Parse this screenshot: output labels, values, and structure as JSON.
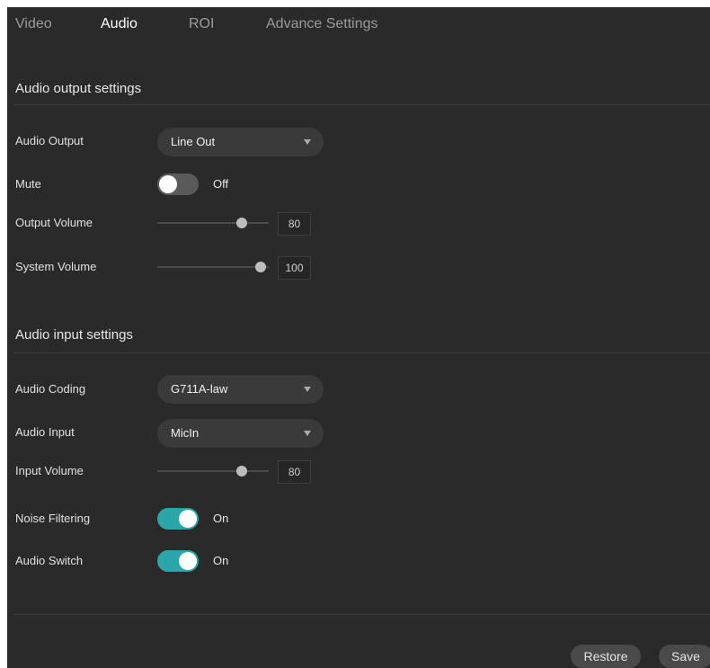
{
  "tabs": [
    {
      "label": "Video"
    },
    {
      "label": "Audio"
    },
    {
      "label": "ROI"
    },
    {
      "label": "Advance Settings"
    }
  ],
  "output_section": {
    "title": "Audio output settings",
    "audio_output": {
      "label": "Audio Output",
      "value": "Line Out"
    },
    "mute": {
      "label": "Mute",
      "state": "Off"
    },
    "output_volume": {
      "label": "Output Volume",
      "value": "80"
    },
    "system_volume": {
      "label": "System Volume",
      "value": "100"
    }
  },
  "input_section": {
    "title": "Audio input settings",
    "audio_coding": {
      "label": "Audio Coding",
      "value": "G711A-law"
    },
    "audio_input": {
      "label": "Audio Input",
      "value": "MicIn"
    },
    "input_volume": {
      "label": "Input Volume",
      "value": "80"
    },
    "noise_filtering": {
      "label": "Noise Filtering",
      "state": "On"
    },
    "audio_switch": {
      "label": "Audio Switch",
      "state": "On"
    }
  },
  "buttons": {
    "restore": "Restore",
    "save": "Save"
  },
  "colors": {
    "panel_bg": "#2a2a2a",
    "toggle_on": "#2aa6a8",
    "toggle_off": "#5a5a5a"
  }
}
